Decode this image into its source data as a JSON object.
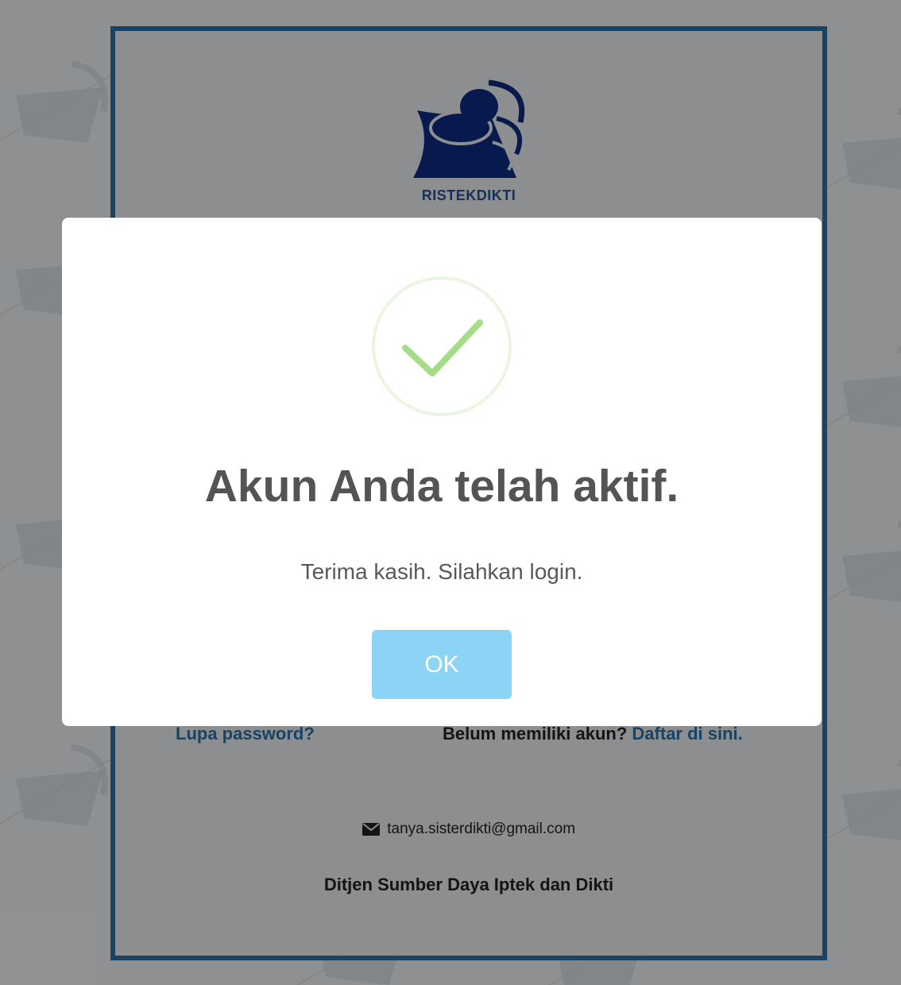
{
  "login_page": {
    "logo_caption": "RISTEKDIKTI",
    "forgot_password_link": "Lupa password?",
    "no_account_text": "Belum memiliki akun?",
    "register_link": "Daftar di sini.",
    "contact_email": "tanya.sisterdikti@gmail.com",
    "contact_icon": "envelope-icon",
    "organization": "Ditjen Sumber Daya Iptek dan Dikti",
    "frame_border_color": "#2c6ea6"
  },
  "modal": {
    "icon": "success-check-icon",
    "title": "Akun Anda telah aktif.",
    "message": "Terima kasih. Silahkan login.",
    "confirm_label": "OK",
    "confirm_color": "#8cd4f5",
    "check_color": "#a5dc86"
  }
}
